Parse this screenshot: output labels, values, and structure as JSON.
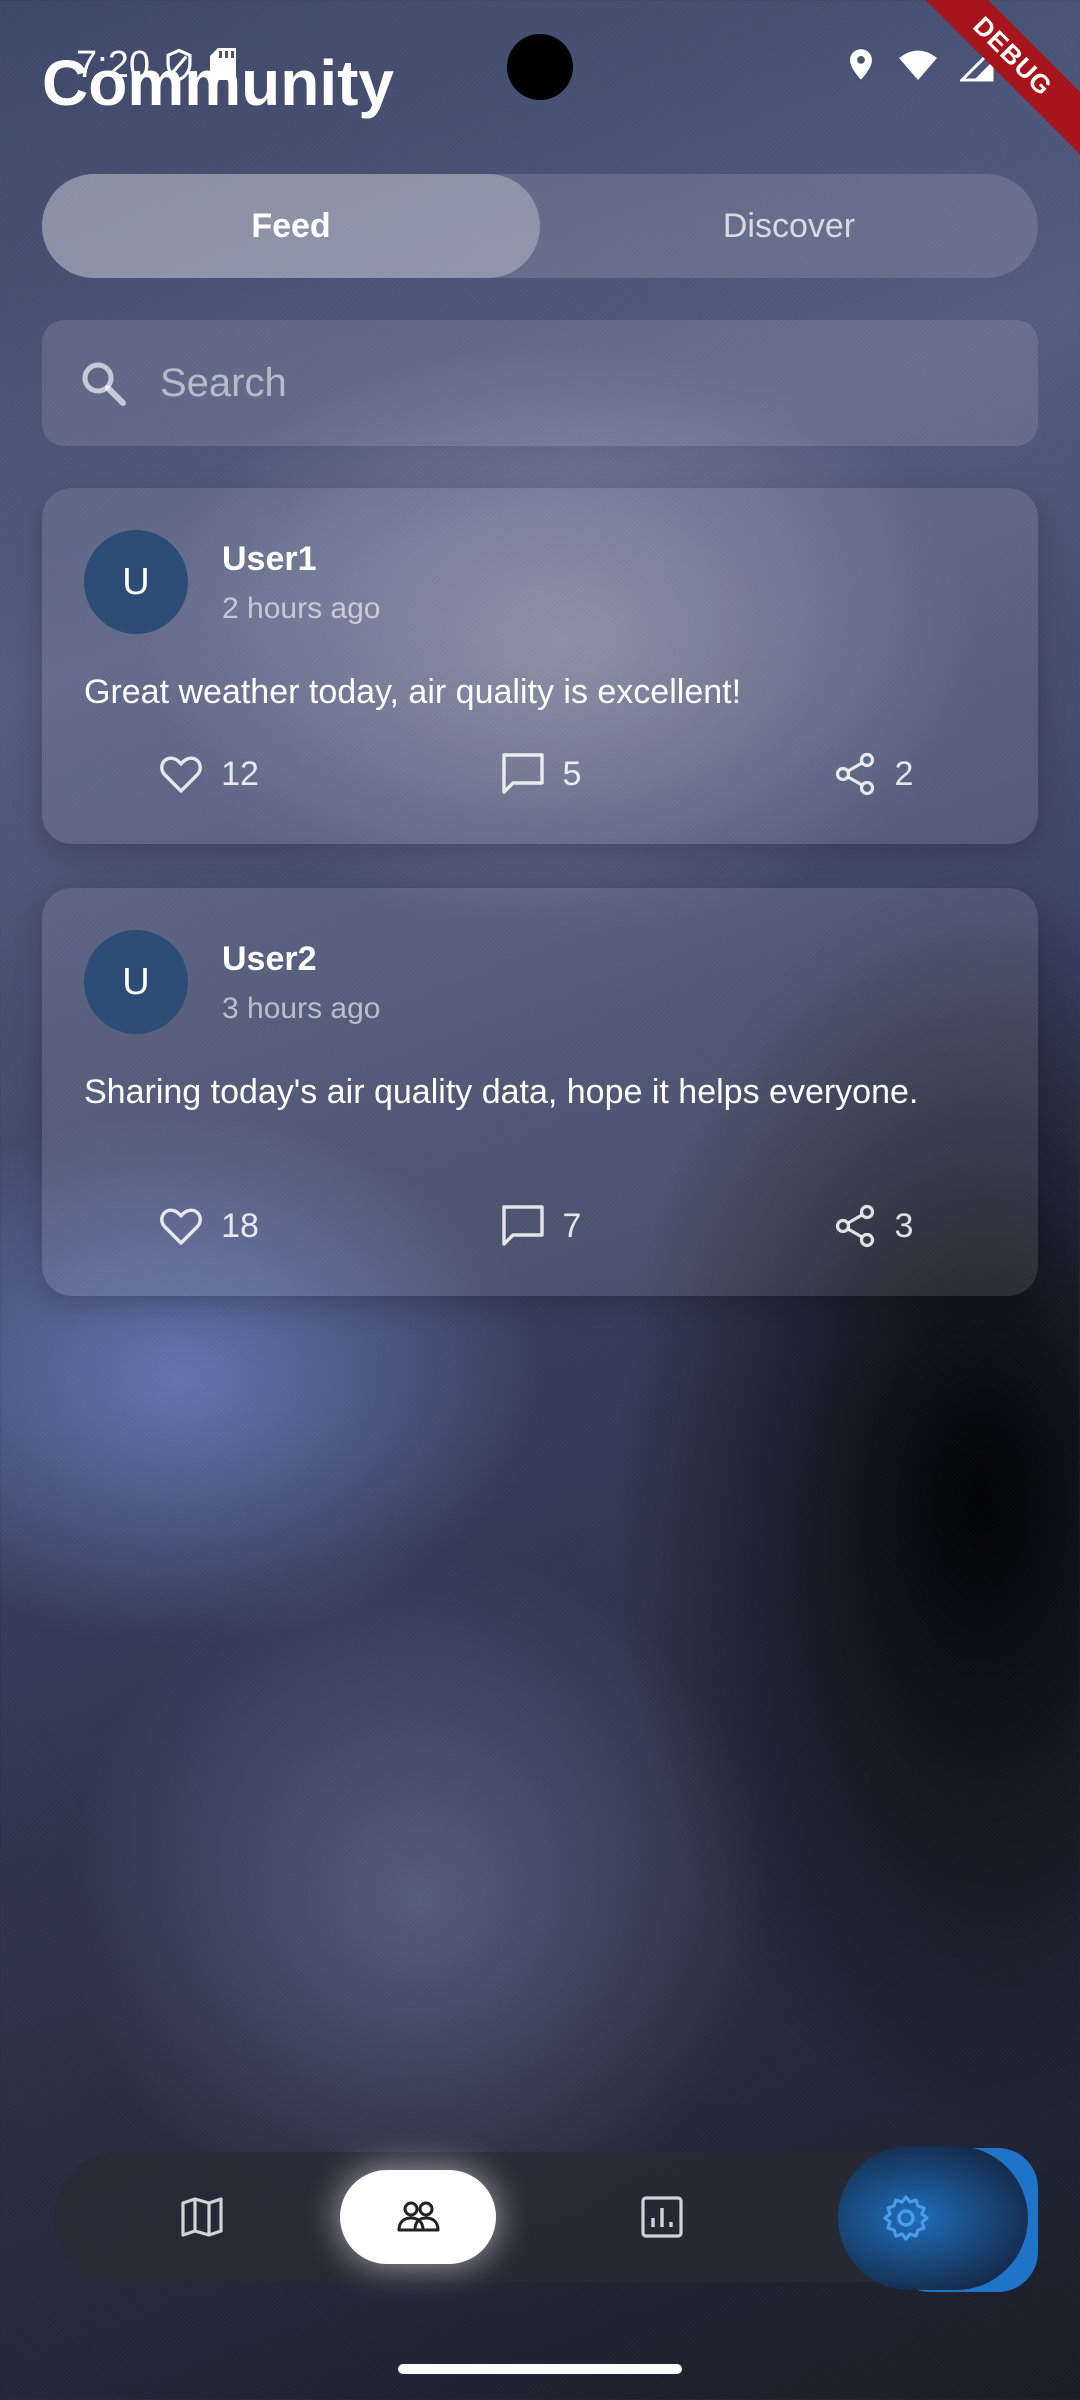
{
  "status_bar": {
    "time": "7:20",
    "icons": [
      "shield-icon",
      "sd-card-icon",
      "location-icon",
      "wifi-icon",
      "signal-icon",
      "battery-icon"
    ],
    "debug_label": "DEBUG"
  },
  "header": {
    "title": "Community"
  },
  "tabs": [
    {
      "label": "Feed",
      "active": true
    },
    {
      "label": "Discover",
      "active": false
    }
  ],
  "search": {
    "placeholder": "Search",
    "value": ""
  },
  "posts": [
    {
      "avatar_letter": "U",
      "user": "User1",
      "time": "2 hours ago",
      "text": "Great weather today, air quality is excellent!",
      "likes": "12",
      "comments": "5",
      "shares": "2"
    },
    {
      "avatar_letter": "U",
      "user": "User2",
      "time": "3 hours ago",
      "text": "Sharing today's air quality data, hope it helps everyone.",
      "likes": "18",
      "comments": "7",
      "shares": "3"
    }
  ],
  "bottom_nav": {
    "items": [
      "map-icon",
      "community-icon",
      "stats-icon",
      "settings-icon"
    ],
    "active": "community-icon"
  },
  "colors": {
    "accent": "#1e74c8",
    "avatar": "#2d4c75",
    "debug_ribbon": "#a8141c"
  }
}
